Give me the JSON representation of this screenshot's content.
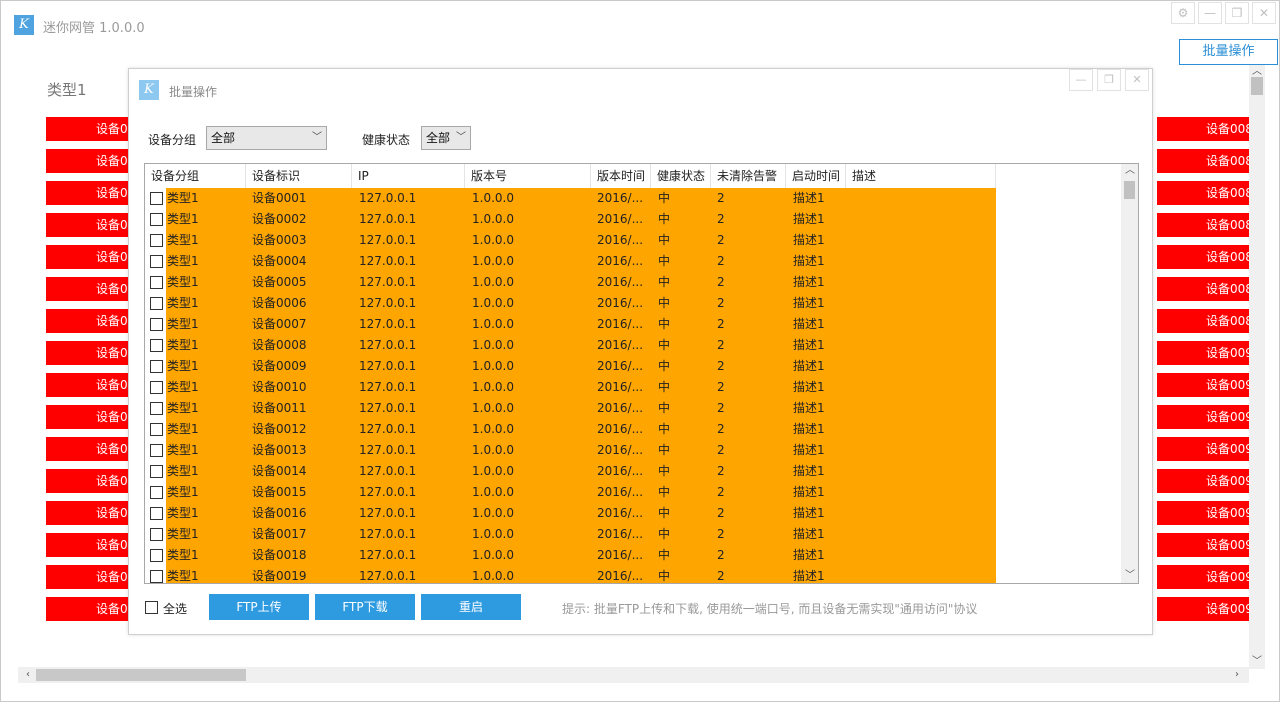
{
  "window": {
    "title": "迷你网管 1.0.0.0",
    "logo": "K",
    "controls": [
      "gear-icon",
      "minimize-icon",
      "restore-icon",
      "close-icon"
    ],
    "batch_button": "批量操作"
  },
  "main": {
    "type_label": "类型1",
    "left_devices": [
      "设备0",
      "设备0",
      "设备0",
      "设备0",
      "设备0",
      "设备0",
      "设备0",
      "设备0",
      "设备0",
      "设备0",
      "设备0",
      "设备0",
      "设备0",
      "设备0",
      "设备0",
      "设备0"
    ],
    "right_devices": [
      "设备008",
      "设备008",
      "设备008",
      "设备008",
      "设备008",
      "设备008",
      "设备008",
      "设备009",
      "设备009",
      "设备009",
      "设备009",
      "设备009",
      "设备009",
      "设备009",
      "设备009",
      "设备009"
    ],
    "device_color": "#ff0000"
  },
  "dialog": {
    "title": "批量操作",
    "logo": "K",
    "group_label": "设备分组",
    "group_value": "全部",
    "health_label": "健康状态",
    "health_value": "全部",
    "columns": [
      "设备分组",
      "设备标识",
      "IP",
      "版本号",
      "版本时间",
      "健康状态",
      "未清除告警",
      "启动时间",
      "描述"
    ],
    "row_color": "#ffa500",
    "rows": [
      {
        "group": "类型1",
        "id": "设备0001",
        "ip": "127.0.0.1",
        "ver": "1.0.0.0",
        "vtime": "2016/...",
        "health": "中",
        "alarms": "2",
        "start": "描述1"
      },
      {
        "group": "类型1",
        "id": "设备0002",
        "ip": "127.0.0.1",
        "ver": "1.0.0.0",
        "vtime": "2016/...",
        "health": "中",
        "alarms": "2",
        "start": "描述1"
      },
      {
        "group": "类型1",
        "id": "设备0003",
        "ip": "127.0.0.1",
        "ver": "1.0.0.0",
        "vtime": "2016/...",
        "health": "中",
        "alarms": "2",
        "start": "描述1"
      },
      {
        "group": "类型1",
        "id": "设备0004",
        "ip": "127.0.0.1",
        "ver": "1.0.0.0",
        "vtime": "2016/...",
        "health": "中",
        "alarms": "2",
        "start": "描述1"
      },
      {
        "group": "类型1",
        "id": "设备0005",
        "ip": "127.0.0.1",
        "ver": "1.0.0.0",
        "vtime": "2016/...",
        "health": "中",
        "alarms": "2",
        "start": "描述1"
      },
      {
        "group": "类型1",
        "id": "设备0006",
        "ip": "127.0.0.1",
        "ver": "1.0.0.0",
        "vtime": "2016/...",
        "health": "中",
        "alarms": "2",
        "start": "描述1"
      },
      {
        "group": "类型1",
        "id": "设备0007",
        "ip": "127.0.0.1",
        "ver": "1.0.0.0",
        "vtime": "2016/...",
        "health": "中",
        "alarms": "2",
        "start": "描述1"
      },
      {
        "group": "类型1",
        "id": "设备0008",
        "ip": "127.0.0.1",
        "ver": "1.0.0.0",
        "vtime": "2016/...",
        "health": "中",
        "alarms": "2",
        "start": "描述1"
      },
      {
        "group": "类型1",
        "id": "设备0009",
        "ip": "127.0.0.1",
        "ver": "1.0.0.0",
        "vtime": "2016/...",
        "health": "中",
        "alarms": "2",
        "start": "描述1"
      },
      {
        "group": "类型1",
        "id": "设备0010",
        "ip": "127.0.0.1",
        "ver": "1.0.0.0",
        "vtime": "2016/...",
        "health": "中",
        "alarms": "2",
        "start": "描述1"
      },
      {
        "group": "类型1",
        "id": "设备0011",
        "ip": "127.0.0.1",
        "ver": "1.0.0.0",
        "vtime": "2016/...",
        "health": "中",
        "alarms": "2",
        "start": "描述1"
      },
      {
        "group": "类型1",
        "id": "设备0012",
        "ip": "127.0.0.1",
        "ver": "1.0.0.0",
        "vtime": "2016/...",
        "health": "中",
        "alarms": "2",
        "start": "描述1"
      },
      {
        "group": "类型1",
        "id": "设备0013",
        "ip": "127.0.0.1",
        "ver": "1.0.0.0",
        "vtime": "2016/...",
        "health": "中",
        "alarms": "2",
        "start": "描述1"
      },
      {
        "group": "类型1",
        "id": "设备0014",
        "ip": "127.0.0.1",
        "ver": "1.0.0.0",
        "vtime": "2016/...",
        "health": "中",
        "alarms": "2",
        "start": "描述1"
      },
      {
        "group": "类型1",
        "id": "设备0015",
        "ip": "127.0.0.1",
        "ver": "1.0.0.0",
        "vtime": "2016/...",
        "health": "中",
        "alarms": "2",
        "start": "描述1"
      },
      {
        "group": "类型1",
        "id": "设备0016",
        "ip": "127.0.0.1",
        "ver": "1.0.0.0",
        "vtime": "2016/...",
        "health": "中",
        "alarms": "2",
        "start": "描述1"
      },
      {
        "group": "类型1",
        "id": "设备0017",
        "ip": "127.0.0.1",
        "ver": "1.0.0.0",
        "vtime": "2016/...",
        "health": "中",
        "alarms": "2",
        "start": "描述1"
      },
      {
        "group": "类型1",
        "id": "设备0018",
        "ip": "127.0.0.1",
        "ver": "1.0.0.0",
        "vtime": "2016/...",
        "health": "中",
        "alarms": "2",
        "start": "描述1"
      },
      {
        "group": "类型1",
        "id": "设备0019",
        "ip": "127.0.0.1",
        "ver": "1.0.0.0",
        "vtime": "2016/...",
        "health": "中",
        "alarms": "2",
        "start": "描述1"
      }
    ],
    "select_all_label": "全选",
    "actions": [
      "FTP上传",
      "FTP下载",
      "重启"
    ],
    "action_color": "#2e9be0",
    "hint": "提示: 批量FTP上传和下载, 使用统一端口号, 而且设备无需实现\"通用访问\"协议"
  }
}
